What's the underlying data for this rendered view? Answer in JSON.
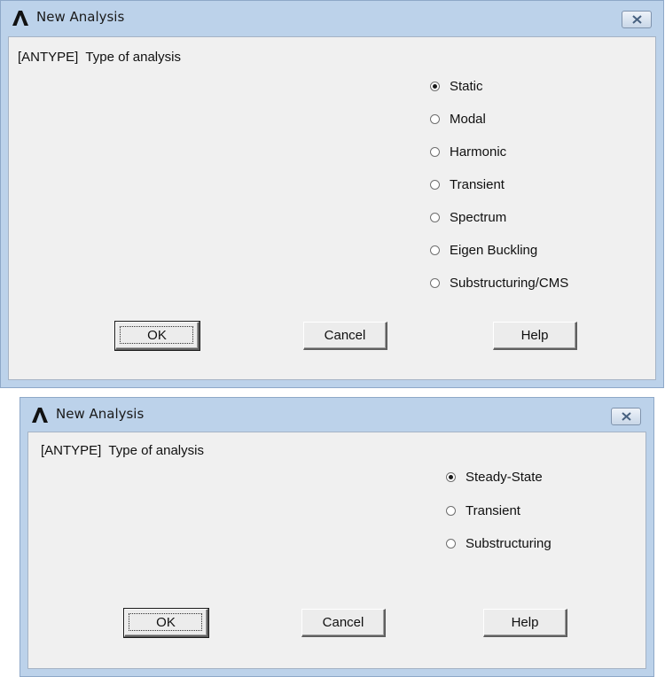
{
  "dialogs": [
    {
      "title": "New Analysis",
      "heading": "[ANTYPE]  Type of analysis",
      "options": [
        {
          "label": "Static",
          "selected": true
        },
        {
          "label": "Modal",
          "selected": false
        },
        {
          "label": "Harmonic",
          "selected": false
        },
        {
          "label": "Transient",
          "selected": false
        },
        {
          "label": "Spectrum",
          "selected": false
        },
        {
          "label": "Eigen Buckling",
          "selected": false
        },
        {
          "label": "Substructuring/CMS",
          "selected": false
        }
      ],
      "buttons": {
        "ok": "OK",
        "cancel": "Cancel",
        "help": "Help"
      }
    },
    {
      "title": "New Analysis",
      "heading": "[ANTYPE]  Type of analysis",
      "options": [
        {
          "label": "Steady-State",
          "selected": true
        },
        {
          "label": "Transient",
          "selected": false
        },
        {
          "label": "Substructuring",
          "selected": false
        }
      ],
      "buttons": {
        "ok": "OK",
        "cancel": "Cancel",
        "help": "Help"
      }
    }
  ],
  "colors": {
    "frame": "#bcd2ea",
    "client": "#f0f0f0",
    "button_face": "#ececec"
  },
  "icons": {
    "app": "ansys-logo-icon",
    "close": "close-icon",
    "radio": "radio-icon"
  }
}
